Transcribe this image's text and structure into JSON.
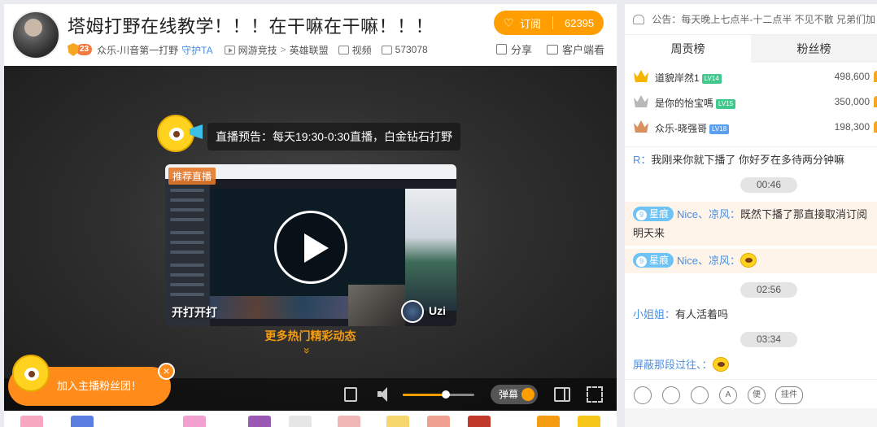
{
  "stream": {
    "title": "塔姆打野在线教学！！！在干嘛在干嘛！！！",
    "fan_level": "23",
    "streamer": "众乐-川音第一打野",
    "guard_label": "守护TA",
    "category": "网游竞技",
    "category_sep": ">",
    "game": "英雄联盟",
    "video_label": "视频",
    "room_id": "573078",
    "subscribe_label": "订阅",
    "subscribe_count": "62395",
    "share_label": "分享",
    "client_label": "客户端看"
  },
  "player": {
    "notice": "直播预告：每天19:30-0:30直播，白金钻石打野",
    "recommend_tag": "推荐直播",
    "card_left_label": "开打开打",
    "card_right_name": "Uzi",
    "more_hot": "更多热门精彩动态",
    "more_arrow": "»",
    "fan_club": "加入主播粉丝团！",
    "close": "×",
    "danmu": "弹幕",
    "volume": 0.6
  },
  "panel": {
    "announcement": "公告：每天晚上七点半-十二点半 不见不散 兄弟们加",
    "tabs": [
      "周贡榜",
      "粉丝榜"
    ],
    "ranks": [
      {
        "name": "道貌岸然1",
        "level": "LV14",
        "score": "498,600",
        "crown_color": "#f5b400",
        "badge_color": "#41c98d"
      },
      {
        "name": "是你的怡宝嗎",
        "level": "LV15",
        "score": "350,000",
        "crown_color": "#b8b8b8",
        "badge_color": "#41c98d"
      },
      {
        "name": "众乐-晓强哥",
        "level": "LV18",
        "score": "198,300",
        "crown_color": "#d99060",
        "badge_color": "#5a9ff0"
      }
    ],
    "chat": [
      {
        "user": "R：",
        "text": "我刚来你就下播了 你好歹在多待两分钟嘛"
      },
      {
        "time": "00:46"
      },
      {
        "badge": "9",
        "badge_label": "星痕",
        "user": "Nice、凉风：",
        "text": "既然下播了那直接取消订阅明天来"
      },
      {
        "badge": "9",
        "badge_label": "星痕",
        "user": "Nice、凉风："
      },
      {
        "time": "02:56"
      },
      {
        "user": "小姐姐：",
        "text": "有人活着吗"
      },
      {
        "time": "03:34"
      },
      {
        "user": "屏蔽那段过往、："
      }
    ],
    "tools": [
      "A",
      "便",
      "挂件"
    ]
  }
}
